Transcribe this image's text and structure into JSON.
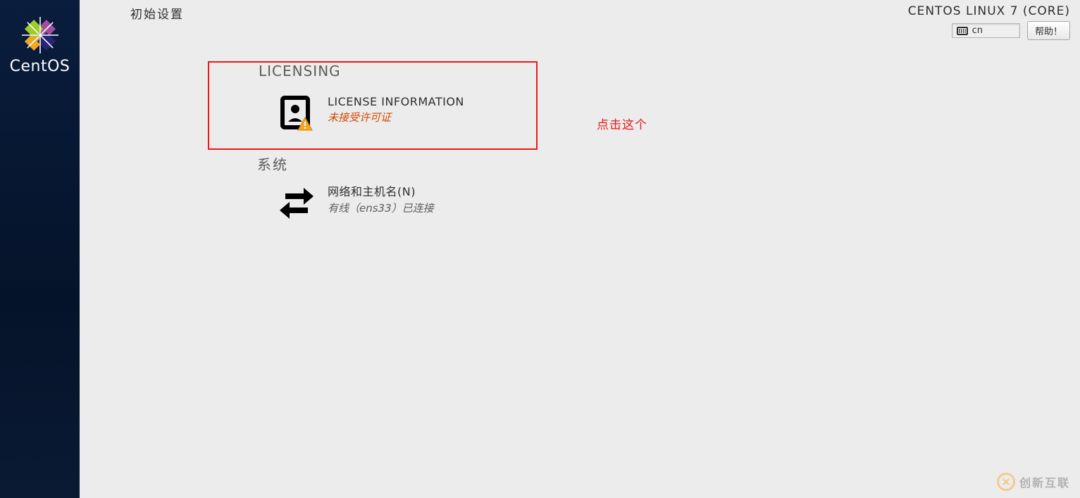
{
  "sidebar": {
    "brand": "CentOS"
  },
  "header": {
    "title": "初始设置",
    "os_name": "CENTOS LINUX 7 (CORE)",
    "lang_code": "cn",
    "help_label": "帮助！"
  },
  "sections": {
    "licensing": {
      "label": "LICENSING",
      "spoke_title": "LICENSE INFORMATION",
      "spoke_status": "未接受许可证"
    },
    "system": {
      "label": "系统",
      "spoke_title": "网络和主机名(N)",
      "spoke_status": "有线（ens33）已连接"
    }
  },
  "annotation": {
    "text": "点击这个"
  },
  "watermark": {
    "text": "创新互联"
  }
}
